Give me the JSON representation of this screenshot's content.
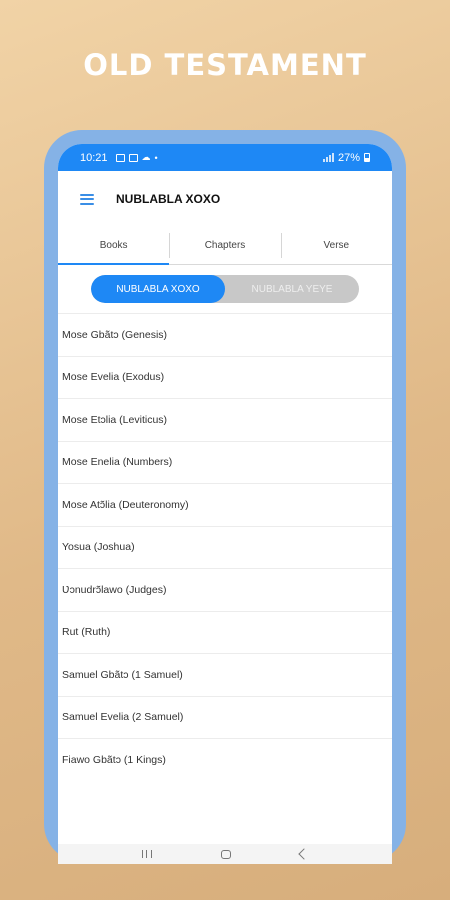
{
  "headline": "OLD TESTAMENT",
  "status_bar": {
    "time": "10:21",
    "left_icons": [
      "image-icon",
      "s-icon",
      "cloud-icon",
      "dot-icon"
    ],
    "battery": "27%"
  },
  "app_bar": {
    "title": "NUBLABLA XOXO"
  },
  "tabs": [
    {
      "label": "Books",
      "active": true
    },
    {
      "label": "Chapters",
      "active": false
    },
    {
      "label": "Verse",
      "active": false
    }
  ],
  "segment": [
    {
      "label": "NUBLABLA XOXO",
      "active": true
    },
    {
      "label": "NUBLABLA YEYE",
      "active": false
    }
  ],
  "books": [
    "Mose Gbãtɔ (Genesis)",
    "Mose Evelia (Exodus)",
    "Mose Etɔlia (Leviticus)",
    "Mose Enelia (Numbers)",
    "Mose Atɔ̃lia (Deuteronomy)",
    "Yosua (Joshua)",
    "Ʋɔnudrɔ̃lawo (Judges)",
    "Rut (Ruth)",
    "Samuel Gbãtɔ (1 Samuel)",
    "Samuel Evelia (2 Samuel)",
    "Fiawo Gbãtɔ (1 Kings)"
  ],
  "colors": {
    "accent": "#1e88f5",
    "phone_frame": "#85b2e6",
    "segment_inactive": "#c8c8c8"
  }
}
